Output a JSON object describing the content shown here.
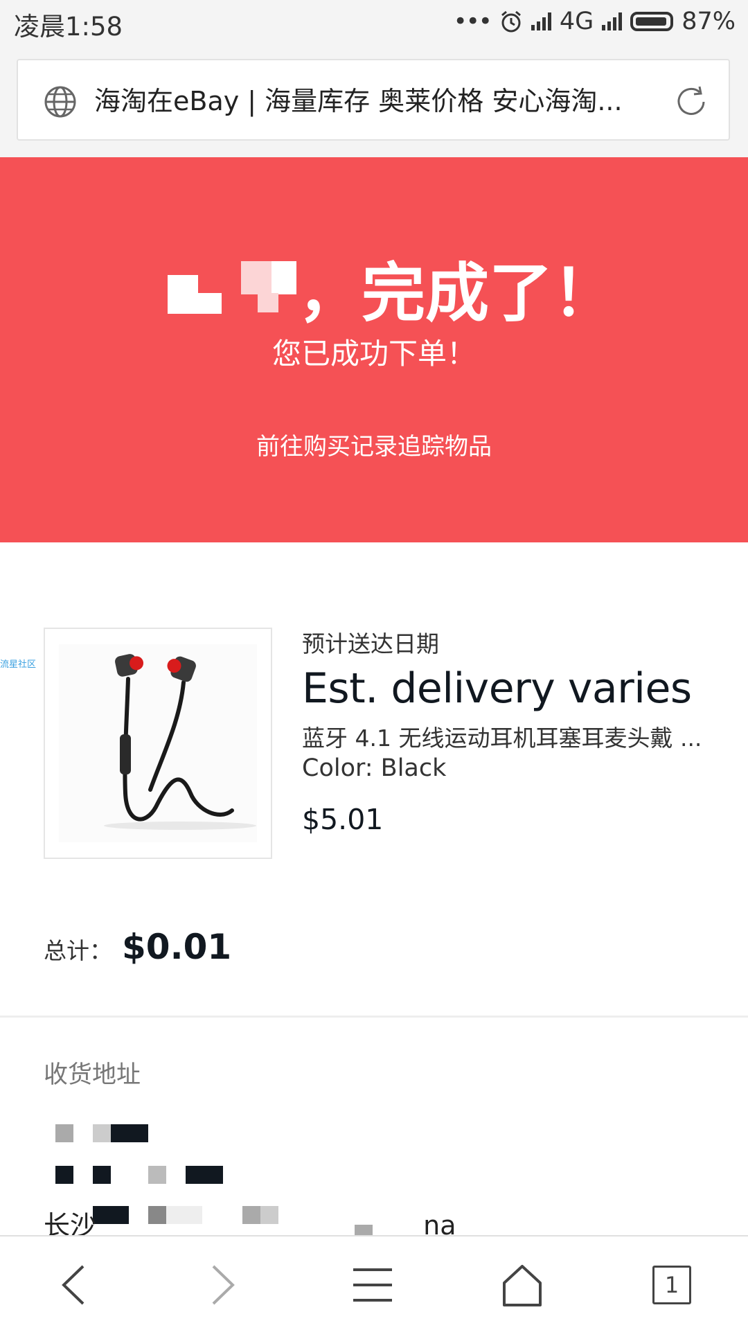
{
  "status_bar": {
    "time": "凌晨1:58",
    "network": "4G",
    "battery": "87%",
    "icons": [
      "more-dots-icon",
      "alarm-icon",
      "signal-icon",
      "signal-icon",
      "battery-icon"
    ]
  },
  "url_bar": {
    "page_title": "海淘在eBay | 海量库存 奥莱价格 安心海淘...",
    "icons": [
      "globe-icon",
      "reload-icon"
    ]
  },
  "banner": {
    "headline": "，完成了！",
    "subtitle": "您已成功下单！",
    "track_link": "前往购买记录追踪物品",
    "color": "#f55155"
  },
  "item": {
    "delivery_label": "预计送达日期",
    "delivery_value": "Est. delivery varies",
    "name": "蓝牙 4.1 无线运动耳机耳塞耳麦头戴 ...",
    "color": "Color: Black",
    "price": "$5.01",
    "side_tag": "流星社区"
  },
  "total": {
    "label": "总计：",
    "value": "$0.01"
  },
  "shipping": {
    "label": "收货地址",
    "city_prefix": "长沙",
    "city_suffix": "na"
  },
  "nav": {
    "tab_count": "1",
    "icons": [
      "back-icon",
      "forward-icon",
      "menu-icon",
      "home-icon",
      "tabs-icon"
    ]
  }
}
